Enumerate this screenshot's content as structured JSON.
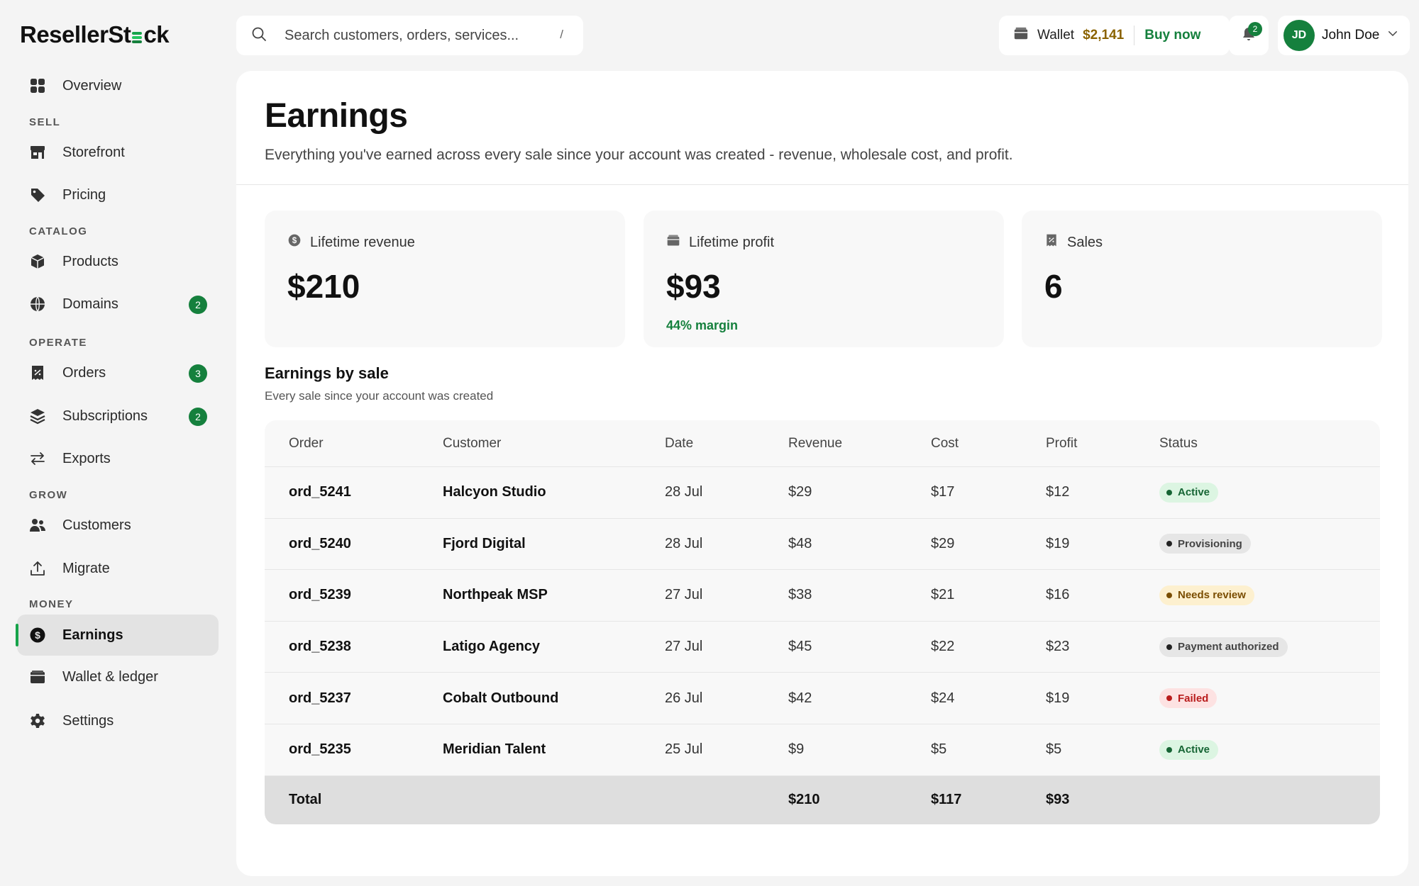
{
  "app": {
    "logo_pre": "ResellerSt",
    "logo_post": "ck"
  },
  "sidebar": {
    "items": [
      {
        "label": "Overview"
      },
      {
        "label": "Storefront"
      },
      {
        "label": "Pricing"
      },
      {
        "label": "Products"
      },
      {
        "label": "Domains",
        "badge": "2"
      },
      {
        "label": "Orders",
        "badge": "3"
      },
      {
        "label": "Subscriptions",
        "badge": "2"
      },
      {
        "label": "Exports"
      },
      {
        "label": "Customers"
      },
      {
        "label": "Migrate"
      },
      {
        "label": "Earnings"
      },
      {
        "label": "Wallet & ledger"
      },
      {
        "label": "Settings"
      }
    ],
    "sections": [
      "SELL",
      "CATALOG",
      "OPERATE",
      "GROW",
      "MONEY"
    ],
    "active": "Earnings"
  },
  "topbar": {
    "search_placeholder": "Search customers, orders, services...",
    "search_shortcut": "/",
    "wallet_label": "Wallet",
    "wallet_amount": "$2,141",
    "buy_label": "Buy now",
    "notifications": "2",
    "user_initials": "JD",
    "user_name": "John Doe"
  },
  "page": {
    "title": "Earnings",
    "subtitle": "Everything you've earned across every sale since your account was created - revenue, wholesale cost, and profit."
  },
  "kpis": {
    "revenue": {
      "label": "Lifetime revenue",
      "value": "$210"
    },
    "profit": {
      "label": "Lifetime profit",
      "value": "$93",
      "note": "44% margin"
    },
    "sales": {
      "label": "Sales",
      "value": "6"
    }
  },
  "table": {
    "title": "Earnings by sale",
    "subtitle": "Every sale since your account was created",
    "columns": [
      "Order",
      "Customer",
      "Date",
      "Revenue",
      "Cost",
      "Profit",
      "Status"
    ],
    "rows": [
      {
        "order": "ord_5241",
        "customer": "Halcyon Studio",
        "date": "28 Jul",
        "revenue": "$29",
        "cost": "$17",
        "profit": "$12",
        "status": "Active"
      },
      {
        "order": "ord_5240",
        "customer": "Fjord Digital",
        "date": "28 Jul",
        "revenue": "$48",
        "cost": "$29",
        "profit": "$19",
        "status": "Provisioning"
      },
      {
        "order": "ord_5239",
        "customer": "Northpeak MSP",
        "date": "27 Jul",
        "revenue": "$38",
        "cost": "$21",
        "profit": "$16",
        "status": "Needs review"
      },
      {
        "order": "ord_5238",
        "customer": "Latigo Agency",
        "date": "27 Jul",
        "revenue": "$45",
        "cost": "$22",
        "profit": "$23",
        "status": "Payment authorized"
      },
      {
        "order": "ord_5237",
        "customer": "Cobalt Outbound",
        "date": "26 Jul",
        "revenue": "$42",
        "cost": "$24",
        "profit": "$19",
        "status": "Failed"
      },
      {
        "order": "ord_5235",
        "customer": "Meridian Talent",
        "date": "25 Jul",
        "revenue": "$9",
        "cost": "$5",
        "profit": "$5",
        "status": "Active"
      }
    ],
    "total": {
      "label": "Total",
      "revenue": "$210",
      "cost": "$117",
      "profit": "$93"
    }
  },
  "colors": {
    "accent": "#15803d",
    "wallet_amount": "#8a6200",
    "status_active": "#166534",
    "status_warn": "#7a4d00",
    "status_fail": "#b91c1c"
  }
}
